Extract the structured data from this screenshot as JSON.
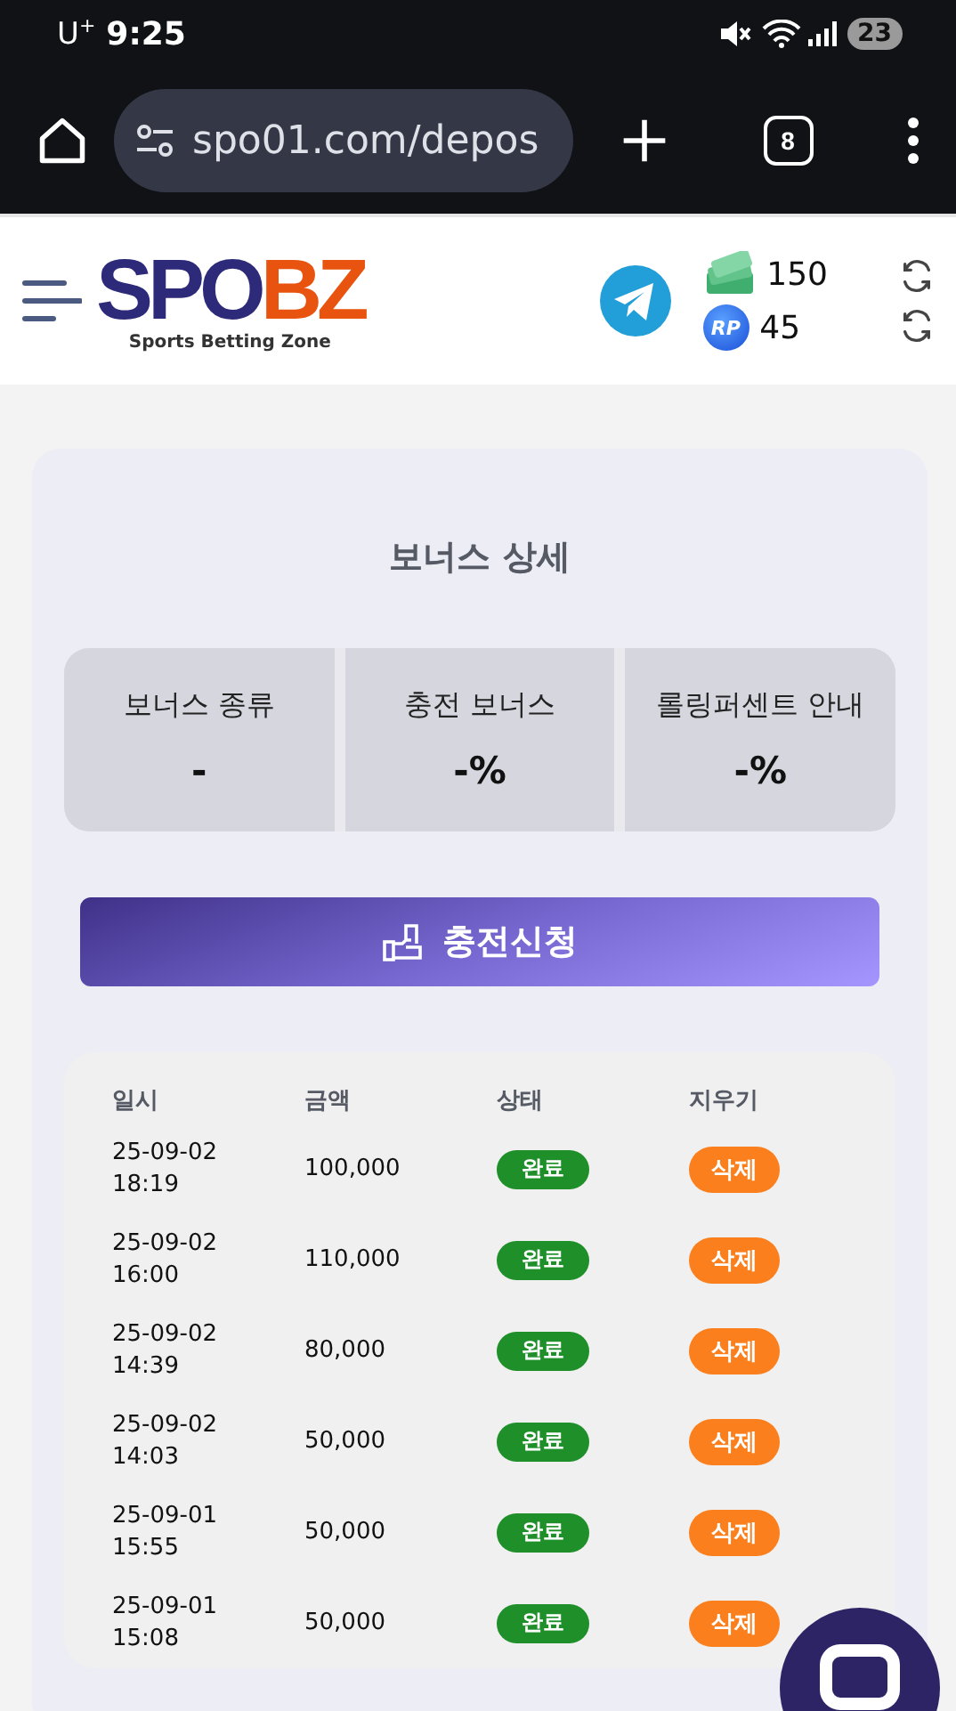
{
  "status_bar": {
    "carrier": "U$^{+}$",
    "time": "9:25",
    "battery": "23"
  },
  "browser": {
    "url": "spo01.com/depos",
    "tab_count": "8"
  },
  "header": {
    "logo": {
      "primary": "SPO",
      "accent": "BZ",
      "tagline": "Sports Betting Zone"
    },
    "balances": [
      {
        "kind": "cash",
        "value": "150"
      },
      {
        "kind": "points",
        "value": "45",
        "badge": "RP"
      }
    ]
  },
  "bonus": {
    "title": "보너스 상세",
    "items": [
      {
        "label": "보너스 종류",
        "value": "-"
      },
      {
        "label": "충전 보너스",
        "value": "-%"
      },
      {
        "label": "롤링퍼센트 안내",
        "value": "-%"
      }
    ]
  },
  "apply_button": "충전신청",
  "table": {
    "columns": [
      "일시",
      "금액",
      "상태",
      "지우기"
    ],
    "rows": [
      {
        "date": "25-09-02",
        "time": "18:19",
        "amount": "100,000",
        "status": "완료",
        "action": "삭제"
      },
      {
        "date": "25-09-02",
        "time": "16:00",
        "amount": "110,000",
        "status": "완료",
        "action": "삭제"
      },
      {
        "date": "25-09-02",
        "time": "14:39",
        "amount": "80,000",
        "status": "완료",
        "action": "삭제"
      },
      {
        "date": "25-09-02",
        "time": "14:03",
        "amount": "50,000",
        "status": "완료",
        "action": "삭제"
      },
      {
        "date": "25-09-01",
        "time": "15:55",
        "amount": "50,000",
        "status": "완료",
        "action": "삭제"
      },
      {
        "date": "25-09-01",
        "time": "15:08",
        "amount": "50,000",
        "status": "완료",
        "action": "삭제"
      }
    ]
  }
}
